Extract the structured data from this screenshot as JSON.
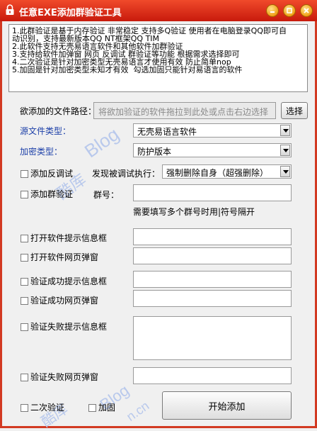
{
  "window": {
    "title": "任意EXE添加群验证工具",
    "icons": {
      "app": "lock-icon",
      "minimize": "minimize-icon",
      "maximize": "maximize-icon",
      "close": "close-icon"
    },
    "accent": "#d23a22"
  },
  "notes": {
    "text": "1.此群验证是基于内存验证 非常稳定 支持多Q验证 使用者在电脑登录QQ即可自\n动识别，支持最新版本QQ NT框架QQ TIM\n2.此软件支持无壳易语言软件和其他软件加群验证\n3.支持给软件加弹窗 网页 反调试 群验证等功能 根据需求选择即可\n4.二次验证是针对加密类型无壳易语言才使用有效 防止简单nop\n5.加固是针对加密类型未知才有效  勾选加固只能针对易语言的软件"
  },
  "file_path": {
    "label": "欲添加的文件路径：",
    "placeholder": "将欲加验证的软件拖拉到此处或点击右边选择",
    "browse_button": "选择"
  },
  "source_type": {
    "label": "源文件类型：",
    "value": "无壳易语言软件"
  },
  "encrypt_type": {
    "label": "加密类型：",
    "value": "防护版本"
  },
  "anti_debug": {
    "checkbox_label": "添加反调试",
    "action_label": "发现被调试执行：",
    "action_value": "强制删除自身（超强删除）"
  },
  "group_verify": {
    "checkbox_label": "添加群验证",
    "group_label": "群号：",
    "group_value": "",
    "hint": "需要填写多个群号时用|符号隔开"
  },
  "options": {
    "open_tip_box": {
      "label": "打开软件提示信息框",
      "value": ""
    },
    "open_web_popup": {
      "label": "打开软件网页弹窗",
      "value": ""
    },
    "success_tip_box": {
      "label": "验证成功提示信息框",
      "value": ""
    },
    "success_web_popup": {
      "label": "验证成功网页弹窗",
      "value": ""
    },
    "fail_tip_box": {
      "label": "验证失败提示信息框",
      "value": ""
    },
    "fail_web_popup": {
      "label": "验证失败网页弹窗",
      "value": ""
    }
  },
  "footer": {
    "second_verify": "二次验证",
    "harden": "加固",
    "start_button": "开始添加"
  },
  "watermark": {
    "text": "Blog",
    "cn": "酷库",
    "suffix": "n.cn"
  }
}
